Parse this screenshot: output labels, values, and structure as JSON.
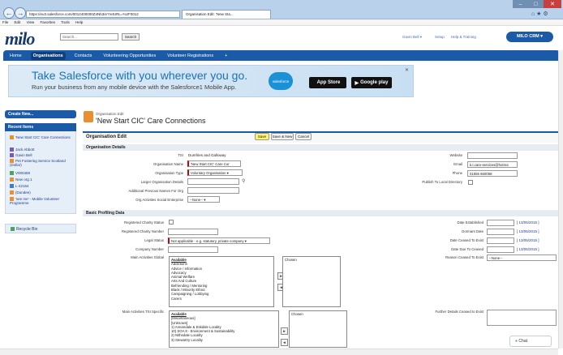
{
  "browser": {
    "url": "https://eu3.salesforce.com/0012400000Z4Nb3/e?retURL=%2F0012",
    "tab_title": "Organisation Edit: 'New Sta...",
    "menu": [
      "File",
      "Edit",
      "View",
      "Favorites",
      "Tools",
      "Help"
    ]
  },
  "header": {
    "logo": "milo",
    "search_placeholder": "Search...",
    "search_button": "Search",
    "user": "Gavin Bell ▾",
    "setup": "Setup",
    "help": "Help & Training",
    "app_menu": "MILO CRM ▾"
  },
  "tabs": [
    "Home",
    "Organisations",
    "Contacts",
    "Volunteering Opportunities",
    "Volunteer Registrations",
    "+"
  ],
  "banner": {
    "title": "Take Salesforce with you wherever you go.",
    "subtitle": "Run your business from any mobile device with the Salesforce1 Mobile App.",
    "cloud": "salesforce",
    "appstore": "App Store",
    "googleplay": "Google play"
  },
  "sidebar": {
    "create_new": "Create New...",
    "recent_items_title": "Recent Items",
    "recent_items": [
      "'New Start CIC' Care Connections",
      "Jack Abbott",
      "Gavin Bell",
      "Pet Fostering Service Scotland (Dollar)",
      "V000458",
      "New org 1",
      "L-42164",
      "(Dundee)",
      "'see me' - Mobile Volunteer Programme"
    ],
    "recycle_bin": "Recycle Bin"
  },
  "page": {
    "small_title": "Organisation Edit",
    "title": "'New Start CIC' Care Connections",
    "edit_heading": "Organisation Edit",
    "buttons": {
      "save": "Save",
      "save_new": "Save & New",
      "cancel": "Cancel"
    }
  },
  "details": {
    "section": "Organisation Details",
    "tsi_label": "TSI",
    "tsi_value": "Dumfries and Galloway",
    "org_name_label": "Organisation Name",
    "org_name_value": "'New Start CIC' Care Cor",
    "org_type_label": "Organisation Type",
    "org_type_value": "Voluntary Organisation ▾",
    "larger_org_label": "Larger Organisation Details",
    "prev_names_label": "Additional Previous Names For Org",
    "social_ent_label": "Org Activities Social Enterprise",
    "social_ent_value": "--None-- ▾",
    "website_label": "Website",
    "email_label": "Email",
    "email_value": "k.t.care-services@hotma",
    "phone_label": "Phone",
    "phone_value": "01556 660058",
    "publish_label": "Publish To Local Directory"
  },
  "profiling": {
    "section": "Basic Profiling Data",
    "charity_status_label": "Registered Charity Status",
    "charity_number_label": "Registered Charity Number",
    "legal_status_label": "Legal Status",
    "legal_status_value": "Not applicable - e.g. statutory, private company ▾",
    "company_number_label": "Company Number",
    "main_global_label": "Main Activities Global",
    "main_tsi_label": "Main Activities TSI Specific",
    "date_established_label": "Date Established",
    "dormant_date_label": "Dormant Date",
    "date_ceased_label": "Date Ceased To Exist",
    "date_due_label": "Date Due To Ceased",
    "date_link": "[ 13/05/2015 ]",
    "reason_ceased_label": "Reason Ceased To Exist",
    "reason_ceased_value": "--None--",
    "further_details_label": "Further Details Ceased to Exist",
    "available_label": "Available",
    "chosen_label": "Chosen",
    "global_options": [
      "Addictions",
      "Advice / Information",
      "Advocacy",
      "Animal Welfare",
      "Arts And Culture",
      "Befriending / Mentoring",
      "Black / Minority Ethnic",
      "Campaigning / Lobbying",
      "Carers"
    ],
    "tsi_options": [
      "[Miscellaneous]",
      "[Unknown]",
      "1) Annandale & Eskdale Locality",
      "10) SOA 8 - Environment & Sustainability",
      "2) Nithsdale Locality",
      "3) Stewartry Locality"
    ]
  },
  "chat": "Chat"
}
